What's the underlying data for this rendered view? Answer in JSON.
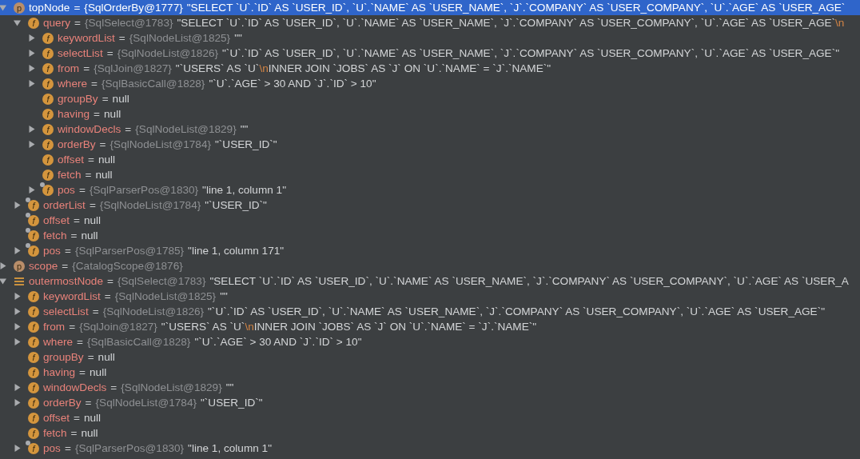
{
  "tree": [
    {
      "name": "topNode",
      "kind": "property",
      "icon_letter": "p",
      "badge": false,
      "expanded": true,
      "selected": true,
      "op": "=",
      "type": "{SqlOrderBy@1777}",
      "value": [
        {
          "kind": "text",
          "text": "\"SELECT `U`.`ID` AS `USER_ID`, `U`.`NAME` AS `USER_NAME`, `J`.`COMPANY` AS `USER_COMPANY`, `U`.`AGE` AS `USER_AGE`"
        }
      ],
      "children": [
        {
          "name": "query",
          "kind": "field",
          "icon_letter": "f",
          "badge": false,
          "expanded": true,
          "selected": false,
          "op": "=",
          "type": "{SqlSelect@1783}",
          "value": [
            {
              "kind": "text",
              "text": "\"SELECT `U`.`ID` AS `USER_ID`, `U`.`NAME` AS `USER_NAME`, `J`.`COMPANY` AS `USER_COMPANY`, `U`.`AGE` AS `USER_AGE`"
            },
            {
              "kind": "escape",
              "text": "\\n"
            }
          ],
          "children": [
            {
              "name": "keywordList",
              "kind": "field",
              "icon_letter": "f",
              "badge": false,
              "expanded": false,
              "selected": false,
              "op": "=",
              "type": "{SqlNodeList@1825}",
              "value": [
                {
                  "kind": "text",
                  "text": "\"\""
                }
              ]
            },
            {
              "name": "selectList",
              "kind": "field",
              "icon_letter": "f",
              "badge": false,
              "expanded": false,
              "selected": false,
              "op": "=",
              "type": "{SqlNodeList@1826}",
              "value": [
                {
                  "kind": "text",
                  "text": "\"`U`.`ID` AS `USER_ID`, `U`.`NAME` AS `USER_NAME`, `J`.`COMPANY` AS `USER_COMPANY`, `U`.`AGE` AS `USER_AGE`\""
                }
              ]
            },
            {
              "name": "from",
              "kind": "field",
              "icon_letter": "f",
              "badge": false,
              "expanded": false,
              "selected": false,
              "op": "=",
              "type": "{SqlJoin@1827}",
              "value": [
                {
                  "kind": "text",
                  "text": "\"`USERS` AS `U`"
                },
                {
                  "kind": "escape",
                  "text": "\\n"
                },
                {
                  "kind": "text",
                  "text": "INNER JOIN `JOBS` AS `J` ON `U`.`NAME` = `J`.`NAME`\""
                }
              ]
            },
            {
              "name": "where",
              "kind": "field",
              "icon_letter": "f",
              "badge": false,
              "expanded": false,
              "selected": false,
              "op": "=",
              "type": "{SqlBasicCall@1828}",
              "value": [
                {
                  "kind": "text",
                  "text": "\"`U`.`AGE` > 30 AND `J`.`ID` > 10\""
                }
              ]
            },
            {
              "name": "groupBy",
              "kind": "field",
              "icon_letter": "f",
              "badge": false,
              "selected": false,
              "op": "=",
              "value": [
                {
                  "kind": "text",
                  "text": "null"
                }
              ]
            },
            {
              "name": "having",
              "kind": "field",
              "icon_letter": "f",
              "badge": false,
              "selected": false,
              "op": "=",
              "value": [
                {
                  "kind": "text",
                  "text": "null"
                }
              ]
            },
            {
              "name": "windowDecls",
              "kind": "field",
              "icon_letter": "f",
              "badge": false,
              "expanded": false,
              "selected": false,
              "op": "=",
              "type": "{SqlNodeList@1829}",
              "value": [
                {
                  "kind": "text",
                  "text": "\"\""
                }
              ]
            },
            {
              "name": "orderBy",
              "kind": "field",
              "icon_letter": "f",
              "badge": false,
              "expanded": false,
              "selected": false,
              "op": "=",
              "type": "{SqlNodeList@1784}",
              "value": [
                {
                  "kind": "text",
                  "text": "\"`USER_ID`\""
                }
              ]
            },
            {
              "name": "offset",
              "kind": "field",
              "icon_letter": "f",
              "badge": false,
              "selected": false,
              "op": "=",
              "value": [
                {
                  "kind": "text",
                  "text": "null"
                }
              ]
            },
            {
              "name": "fetch",
              "kind": "field",
              "icon_letter": "f",
              "badge": false,
              "selected": false,
              "op": "=",
              "value": [
                {
                  "kind": "text",
                  "text": "null"
                }
              ]
            },
            {
              "name": "pos",
              "kind": "field",
              "icon_letter": "f",
              "badge": true,
              "expanded": false,
              "selected": false,
              "op": "=",
              "type": "{SqlParserPos@1830}",
              "value": [
                {
                  "kind": "text",
                  "text": "\"line 1, column 1\""
                }
              ]
            }
          ]
        },
        {
          "name": "orderList",
          "kind": "field",
          "icon_letter": "f",
          "badge": true,
          "expanded": false,
          "selected": false,
          "op": "=",
          "type": "{SqlNodeList@1784}",
          "value": [
            {
              "kind": "text",
              "text": "\"`USER_ID`\""
            }
          ]
        },
        {
          "name": "offset",
          "kind": "field",
          "icon_letter": "f",
          "badge": true,
          "selected": false,
          "op": "=",
          "value": [
            {
              "kind": "text",
              "text": "null"
            }
          ]
        },
        {
          "name": "fetch",
          "kind": "field",
          "icon_letter": "f",
          "badge": true,
          "selected": false,
          "op": "=",
          "value": [
            {
              "kind": "text",
              "text": "null"
            }
          ]
        },
        {
          "name": "pos",
          "kind": "field",
          "icon_letter": "f",
          "badge": true,
          "expanded": false,
          "selected": false,
          "op": "=",
          "type": "{SqlParserPos@1785}",
          "value": [
            {
              "kind": "text",
              "text": "\"line 1, column 171\""
            }
          ]
        }
      ]
    },
    {
      "name": "scope",
      "kind": "property",
      "icon_letter": "p",
      "badge": false,
      "expanded": false,
      "selected": false,
      "op": "=",
      "type": "{CatalogScope@1876}"
    },
    {
      "name": "outermostNode",
      "kind": "list",
      "badge": false,
      "expanded": true,
      "selected": false,
      "op": "=",
      "type": "{SqlSelect@1783}",
      "value": [
        {
          "kind": "text",
          "text": "\"SELECT `U`.`ID` AS `USER_ID`, `U`.`NAME` AS `USER_NAME`, `J`.`COMPANY` AS `USER_COMPANY`, `U`.`AGE` AS `USER_A"
        }
      ],
      "children": [
        {
          "name": "keywordList",
          "kind": "field",
          "icon_letter": "f",
          "badge": false,
          "expanded": false,
          "selected": false,
          "op": "=",
          "type": "{SqlNodeList@1825}",
          "value": [
            {
              "kind": "text",
              "text": "\"\""
            }
          ]
        },
        {
          "name": "selectList",
          "kind": "field",
          "icon_letter": "f",
          "badge": false,
          "expanded": false,
          "selected": false,
          "op": "=",
          "type": "{SqlNodeList@1826}",
          "value": [
            {
              "kind": "text",
              "text": "\"`U`.`ID` AS `USER_ID`, `U`.`NAME` AS `USER_NAME`, `J`.`COMPANY` AS `USER_COMPANY`, `U`.`AGE` AS `USER_AGE`\""
            }
          ]
        },
        {
          "name": "from",
          "kind": "field",
          "icon_letter": "f",
          "badge": false,
          "expanded": false,
          "selected": false,
          "op": "=",
          "type": "{SqlJoin@1827}",
          "value": [
            {
              "kind": "text",
              "text": "\"`USERS` AS `U`"
            },
            {
              "kind": "escape",
              "text": "\\n"
            },
            {
              "kind": "text",
              "text": "INNER JOIN `JOBS` AS `J` ON `U`.`NAME` = `J`.`NAME`\""
            }
          ]
        },
        {
          "name": "where",
          "kind": "field",
          "icon_letter": "f",
          "badge": false,
          "expanded": false,
          "selected": false,
          "op": "=",
          "type": "{SqlBasicCall@1828}",
          "value": [
            {
              "kind": "text",
              "text": "\"`U`.`AGE` > 30 AND `J`.`ID` > 10\""
            }
          ]
        },
        {
          "name": "groupBy",
          "kind": "field",
          "icon_letter": "f",
          "badge": false,
          "selected": false,
          "op": "=",
          "value": [
            {
              "kind": "text",
              "text": "null"
            }
          ]
        },
        {
          "name": "having",
          "kind": "field",
          "icon_letter": "f",
          "badge": false,
          "selected": false,
          "op": "=",
          "value": [
            {
              "kind": "text",
              "text": "null"
            }
          ]
        },
        {
          "name": "windowDecls",
          "kind": "field",
          "icon_letter": "f",
          "badge": false,
          "expanded": false,
          "selected": false,
          "op": "=",
          "type": "{SqlNodeList@1829}",
          "value": [
            {
              "kind": "text",
              "text": "\"\""
            }
          ]
        },
        {
          "name": "orderBy",
          "kind": "field",
          "icon_letter": "f",
          "badge": false,
          "expanded": false,
          "selected": false,
          "op": "=",
          "type": "{SqlNodeList@1784}",
          "value": [
            {
              "kind": "text",
              "text": "\"`USER_ID`\""
            }
          ]
        },
        {
          "name": "offset",
          "kind": "field",
          "icon_letter": "f",
          "badge": false,
          "selected": false,
          "op": "=",
          "value": [
            {
              "kind": "text",
              "text": "null"
            }
          ]
        },
        {
          "name": "fetch",
          "kind": "field",
          "icon_letter": "f",
          "badge": false,
          "selected": false,
          "op": "=",
          "value": [
            {
              "kind": "text",
              "text": "null"
            }
          ]
        },
        {
          "name": "pos",
          "kind": "field",
          "icon_letter": "f",
          "badge": true,
          "expanded": false,
          "selected": false,
          "op": "=",
          "type": "{SqlParserPos@1830}",
          "value": [
            {
              "kind": "text",
              "text": "\"line 1, column 1\""
            }
          ]
        }
      ]
    }
  ]
}
